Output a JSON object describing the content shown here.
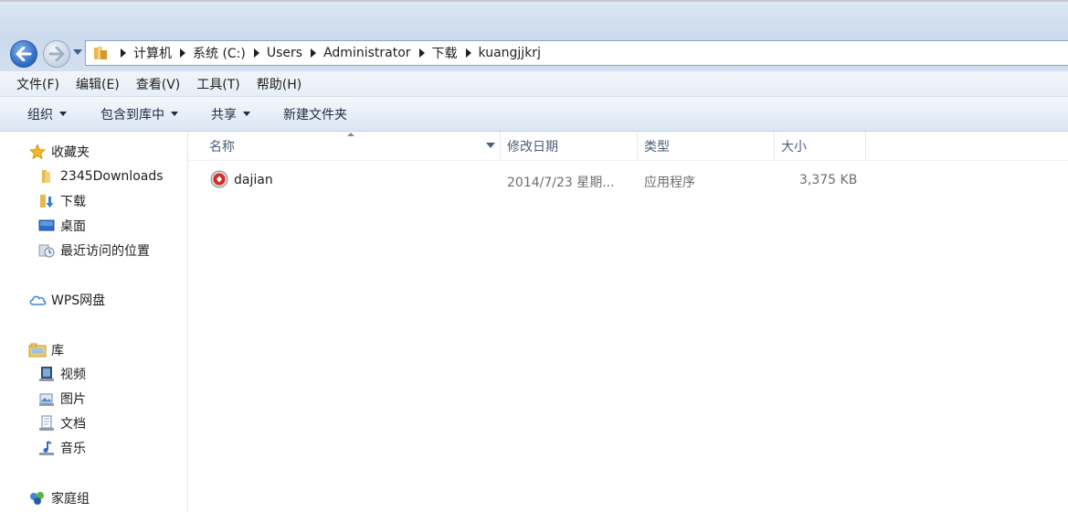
{
  "address": {
    "crumbs": [
      "计算机",
      "系统 (C:)",
      "Users",
      "Administrator",
      "下载",
      "kuangjjkrj"
    ]
  },
  "menu": [
    "文件(F)",
    "编辑(E)",
    "查看(V)",
    "工具(T)",
    "帮助(H)"
  ],
  "toolbar": {
    "organize": "组织",
    "include_library": "包含到库中",
    "share": "共享",
    "new_folder": "新建文件夹"
  },
  "nav": {
    "favorites": "收藏夹",
    "fav_items": [
      "2345Downloads",
      "下载",
      "桌面",
      "最近访问的位置"
    ],
    "wps": "WPS网盘",
    "libraries": "库",
    "lib_items": [
      "视频",
      "图片",
      "文档",
      "音乐"
    ],
    "homegroup": "家庭组"
  },
  "columns": {
    "name": "名称",
    "modified": "修改日期",
    "type": "类型",
    "size": "大小"
  },
  "files": [
    {
      "name": "dajian",
      "modified": "2014/7/23 星期...",
      "type": "应用程序",
      "size": "3,375 KB"
    }
  ],
  "colors": {
    "accent": "#2a67c4",
    "toolbar_text": "#1e2b44",
    "header_text": "#4c607a"
  }
}
